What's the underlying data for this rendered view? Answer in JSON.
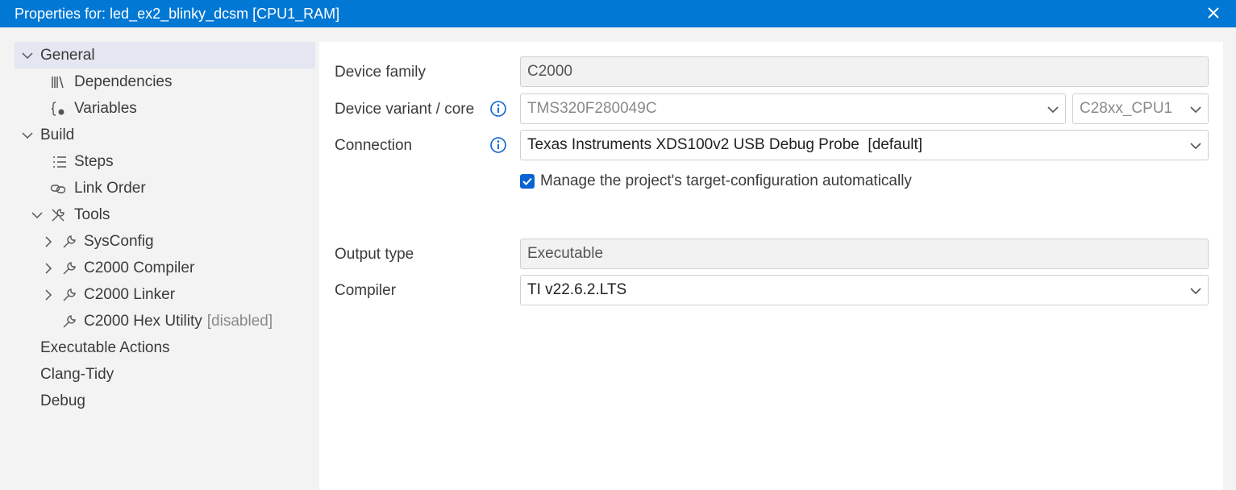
{
  "window": {
    "title": "Properties for: led_ex2_blinky_dcsm [CPU1_RAM]"
  },
  "sidebar": {
    "items": [
      {
        "label": "General",
        "expanded": true,
        "icon": "chevron-down-icon"
      },
      {
        "label": "Dependencies",
        "icon": "library-icon"
      },
      {
        "label": "Variables",
        "icon": "variable-braces-icon"
      },
      {
        "label": "Build",
        "expanded": true,
        "icon": "chevron-down-icon"
      },
      {
        "label": "Steps",
        "icon": "list-icon"
      },
      {
        "label": "Link Order",
        "icon": "link-icon"
      },
      {
        "label": "Tools",
        "expanded": true,
        "icon": "tools-icon"
      },
      {
        "label": "SysConfig",
        "expanded": false,
        "icon": "wrench-icon"
      },
      {
        "label": "C2000 Compiler",
        "expanded": false,
        "icon": "wrench-icon"
      },
      {
        "label": "C2000 Linker",
        "expanded": false,
        "icon": "wrench-icon"
      },
      {
        "label": "C2000 Hex Utility",
        "tag": "[disabled]",
        "icon": "wrench-icon"
      },
      {
        "label": "Executable Actions"
      },
      {
        "label": "Clang-Tidy"
      },
      {
        "label": "Debug"
      }
    ]
  },
  "form": {
    "device_family": {
      "label": "Device family",
      "value": "C2000"
    },
    "device_variant": {
      "label": "Device variant / core",
      "value": "TMS320F280049C",
      "core": "C28xx_CPU1"
    },
    "connection": {
      "label": "Connection",
      "value": "Texas Instruments XDS100v2 USB Debug Probe  [default]"
    },
    "manage_target": {
      "label": "Manage the project's target-configuration automatically",
      "checked": true
    },
    "output_type": {
      "label": "Output type",
      "value": "Executable"
    },
    "compiler": {
      "label": "Compiler",
      "value": "TI v22.6.2.LTS"
    }
  },
  "colors": {
    "titlebar": "#0078d4",
    "selection": "#e4e6f1",
    "checkbox": "#0a63d1",
    "info": "#0a63d1"
  }
}
